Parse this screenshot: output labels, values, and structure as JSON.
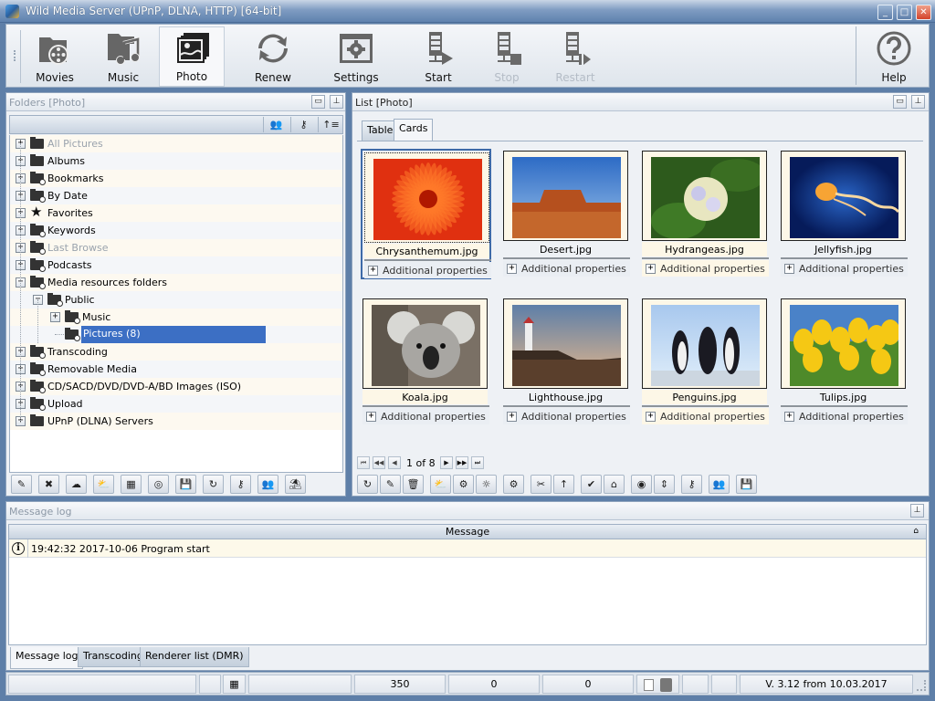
{
  "window": {
    "title": "Wild Media Server (UPnP, DLNA, HTTP) [64-bit]",
    "controls": [
      "minimize",
      "maximize",
      "close"
    ]
  },
  "toolbar": {
    "buttons": [
      {
        "label": "Movies",
        "icon": "movies-folder-icon",
        "active": false,
        "enabled": true
      },
      {
        "label": "Music",
        "icon": "music-folder-icon",
        "active": false,
        "enabled": true
      },
      {
        "label": "Photo",
        "icon": "photo-icon",
        "active": true,
        "enabled": true
      },
      {
        "label": "Renew",
        "icon": "renew-icon",
        "active": false,
        "enabled": true
      },
      {
        "label": "Settings",
        "icon": "settings-icon",
        "active": false,
        "enabled": true
      },
      {
        "label": "Start",
        "icon": "server-start-icon",
        "active": false,
        "enabled": true
      },
      {
        "label": "Stop",
        "icon": "server-stop-icon",
        "active": false,
        "enabled": false
      },
      {
        "label": "Restart",
        "icon": "server-restart-icon",
        "active": false,
        "enabled": false
      },
      {
        "label": "Help",
        "icon": "help-icon",
        "active": false,
        "enabled": true
      }
    ]
  },
  "folders": {
    "title": "Folders [Photo]",
    "header_icons": [
      "users-icon",
      "key-icon",
      "sort-icon"
    ],
    "tree": [
      {
        "label": "All Pictures",
        "level": 0,
        "expander": "+",
        "icon": "open-folder-icon",
        "dim": true
      },
      {
        "label": "Albums",
        "level": 0,
        "expander": "+",
        "icon": "albums-icon",
        "dim": false
      },
      {
        "label": "Bookmarks",
        "level": 0,
        "expander": "+",
        "icon": "bookmark-folder-icon",
        "dim": false
      },
      {
        "label": "By Date",
        "level": 0,
        "expander": "+",
        "icon": "date-folder-icon",
        "dim": false
      },
      {
        "label": "Favorites",
        "level": 0,
        "expander": "+",
        "icon": "star-icon",
        "dim": false
      },
      {
        "label": "Keywords",
        "level": 0,
        "expander": "+",
        "icon": "keywords-folder-icon",
        "dim": false
      },
      {
        "label": "Last Browse",
        "level": 0,
        "expander": "+",
        "icon": "history-folder-icon",
        "dim": true
      },
      {
        "label": "Podcasts",
        "level": 0,
        "expander": "+",
        "icon": "podcast-folder-icon",
        "dim": false
      },
      {
        "label": "Media resources folders",
        "level": 0,
        "expander": "-",
        "icon": "search-folder-icon",
        "dim": false
      },
      {
        "label": "Public",
        "level": 1,
        "expander": "-",
        "icon": "search-folder-icon",
        "dim": false
      },
      {
        "label": "Music",
        "level": 2,
        "expander": "+",
        "icon": "search-folder-icon",
        "dim": false
      },
      {
        "label": "Pictures (8)",
        "level": 2,
        "expander": "",
        "icon": "search-folder-icon",
        "dim": false,
        "selected": true
      },
      {
        "label": "Transcoding",
        "level": 0,
        "expander": "+",
        "icon": "transcode-folder-icon",
        "dim": false
      },
      {
        "label": "Removable Media",
        "level": 0,
        "expander": "+",
        "icon": "removable-media-icon",
        "dim": false
      },
      {
        "label": "CD/SACD/DVD/DVD-A/BD Images (ISO)",
        "level": 0,
        "expander": "+",
        "icon": "disc-image-folder-icon",
        "dim": false
      },
      {
        "label": "Upload",
        "level": 0,
        "expander": "+",
        "icon": "upload-folder-icon",
        "dim": false
      },
      {
        "label": "UPnP (DLNA) Servers",
        "level": 0,
        "expander": "+",
        "icon": "open-folder-icon",
        "dim": false
      }
    ],
    "tools": [
      "edit-folder-icon",
      "delete-folder-icon",
      "cloud-folder-icon",
      "weather-icon",
      "grid-icon",
      "lifebuoy-icon",
      "save-icon",
      "refresh-folder-icon",
      "key-icon",
      "users-icon",
      "palm-tree-icon"
    ]
  },
  "list": {
    "title": "List [Photo]",
    "tabs": [
      {
        "label": "Table",
        "active": false
      },
      {
        "label": "Cards",
        "active": true
      }
    ],
    "cards": [
      {
        "name": "Chrysanthemum.jpg",
        "props": "Additional properties",
        "selected": true,
        "thumb": "chrysanthemum"
      },
      {
        "name": "Desert.jpg",
        "props": "Additional properties",
        "selected": false,
        "thumb": "desert"
      },
      {
        "name": "Hydrangeas.jpg",
        "props": "Additional properties",
        "selected": false,
        "thumb": "hydrangeas"
      },
      {
        "name": "Jellyfish.jpg",
        "props": "Additional properties",
        "selected": false,
        "thumb": "jellyfish"
      },
      {
        "name": "Koala.jpg",
        "props": "Additional properties",
        "selected": false,
        "thumb": "koala"
      },
      {
        "name": "Lighthouse.jpg",
        "props": "Additional properties",
        "selected": false,
        "thumb": "lighthouse"
      },
      {
        "name": "Penguins.jpg",
        "props": "Additional properties",
        "selected": false,
        "thumb": "penguins"
      },
      {
        "name": "Tulips.jpg",
        "props": "Additional properties",
        "selected": false,
        "thumb": "tulips"
      }
    ],
    "pager": {
      "text": "1 of 8",
      "current": 1,
      "total": 8
    },
    "tools": [
      "refresh-icon",
      "edit-icon",
      "delete-icon",
      "weather-icon",
      "settings-info-icon",
      "brightness-icon",
      "folder-settings-icon",
      "tools-icon",
      "sort-icon",
      "folder-check-icon",
      "folder-open-icon",
      "broadcast-icon",
      "fit-height-icon",
      "key-icon",
      "users-icon",
      "save-icon"
    ]
  },
  "message_log": {
    "title": "Message log",
    "column": "Message",
    "rows": [
      {
        "icon": "info-icon",
        "text": "19:42:32 2017-10-06 Program start"
      }
    ],
    "tabs": [
      {
        "label": "Message log",
        "active": true
      },
      {
        "label": "Transcoding",
        "active": false
      },
      {
        "label": "Renderer list (DMR)",
        "active": false
      }
    ]
  },
  "statusbar": {
    "cells": [
      "",
      "",
      "",
      "350",
      "0",
      "0",
      "",
      "",
      "V. 3.12 from 10.03.2017"
    ]
  }
}
